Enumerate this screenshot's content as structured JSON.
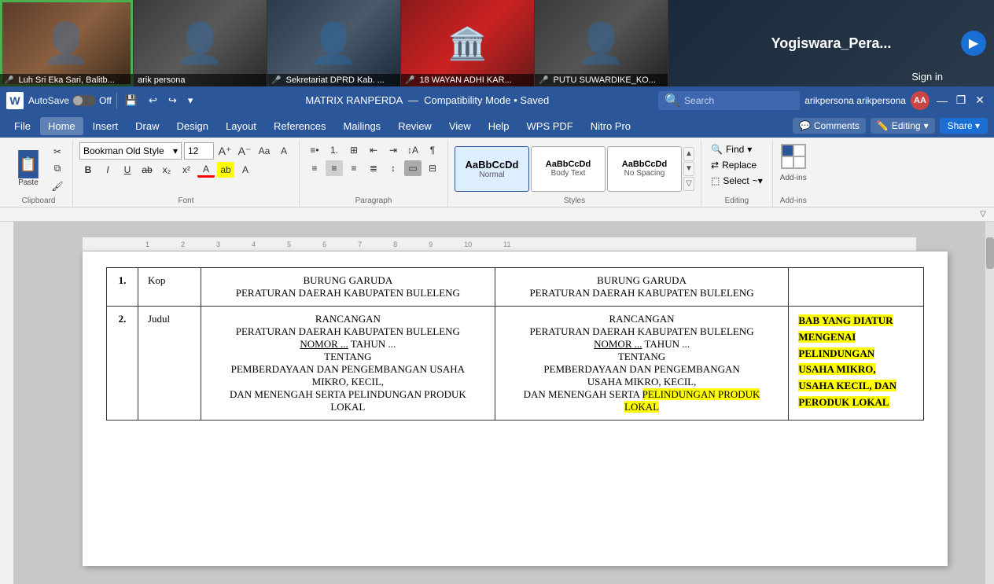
{
  "video_bar": {
    "participants": [
      {
        "id": 1,
        "name": "Luh Sri Eka Sari, Balitb...",
        "bg": "thumb-bg-1",
        "muted": true,
        "is_person": true
      },
      {
        "id": 2,
        "name": "arik persona",
        "bg": "thumb-bg-2",
        "muted": false,
        "is_person": true,
        "speaking": true
      },
      {
        "id": 3,
        "name": "Sekretariat DPRD Kab. ...",
        "bg": "thumb-bg-3",
        "muted": true,
        "is_person": true
      },
      {
        "id": 4,
        "name": "18 WAYAN ADHI KAR...",
        "bg": "thumb-bg-4",
        "muted": true,
        "is_person": false
      },
      {
        "id": 5,
        "name": "PUTU SUWARDIKE_KO...",
        "bg": "thumb-bg-5",
        "muted": true,
        "is_person": false
      }
    ],
    "featured_name": "Yogiswara_Pera...",
    "sign_in_label": "Sign in"
  },
  "app_bar": {
    "logo": "W",
    "autosave_label": "AutoSave",
    "autosave_state": "Off",
    "save_icon": "💾",
    "undo_icon": "↩",
    "redo_icon": "↪",
    "dropdown_icon": "▾",
    "doc_title": "MATRIX RANPERDA",
    "doc_subtitle": "Compatibility Mode • Saved",
    "search_placeholder": "Search",
    "user_name": "arikpersona arikpersona",
    "user_initials": "AA",
    "minimize_icon": "—",
    "restore_icon": "❐",
    "close_icon": "✕"
  },
  "menu_bar": {
    "items": [
      "File",
      "Home",
      "Insert",
      "Draw",
      "Design",
      "Layout",
      "References",
      "Mailings",
      "Review",
      "View",
      "Help",
      "WPS PDF",
      "Nitro Pro"
    ],
    "active_item": "Home",
    "comments_label": "Comments",
    "editing_label": "Editing",
    "editing_dropdown": "▾",
    "share_label": "Share",
    "share_dropdown": "▾"
  },
  "ribbon": {
    "clipboard": {
      "paste_label": "Paste",
      "cut_label": "✂",
      "copy_label": "⧉",
      "format_painter_label": "🖌"
    },
    "font": {
      "name": "Bookman Old Style",
      "size": "12",
      "grow_icon": "A↑",
      "shrink_icon": "A↓",
      "case_icon": "Aa",
      "clear_icon": "A",
      "bold": "B",
      "italic": "I",
      "underline": "U",
      "strikethrough": "ab",
      "subscript": "x₂",
      "superscript": "x²",
      "font_color": "A",
      "highlight": "ab"
    },
    "paragraph": {
      "label": "Paragraph"
    },
    "styles": {
      "label": "Styles",
      "normal_label": "Normal",
      "body_text_label": "Body Text",
      "no_spacing_label": "No Spacing",
      "normal_active": true
    },
    "editing": {
      "label": "Editing",
      "find_label": "Find",
      "replace_label": "Replace",
      "select_label": "Select",
      "select_dropdown": "~"
    },
    "addins": {
      "label": "Add-ins"
    }
  },
  "document": {
    "table": {
      "headers": [],
      "rows": [
        {
          "num": "1.",
          "label": "Kop",
          "col1": "BURUNG GARUDA\nPERATURAN DAERAH KABUPATEN BULELENG",
          "col2": "BURUNG GARUDA\nPERATURAN DAERAH KABUPATEN BULELENG",
          "note": ""
        },
        {
          "num": "2.",
          "label": "Judul",
          "col1": "RANCANGAN\nPERATURAN DAERAH KABUPATEN BULELENG\nNOMOR ... TAHUN ...\nTENTANG\nPEMBERDAYAAN DAN PENGEMBANGAN USAHA\nMIKRO, KECIL,\nDAN MENENGAH SERTA PELINDUNGAN PRODUK\nLOKAL",
          "col2_parts": [
            {
              "text": "RANCANGAN\nPERATURAN DAERAH KABUPATEN BULELENG\nNOMOR ... TAHUN ...\nTENTANG\nPEMBERDAYAAN DAN PENGEMBANGAN\nUSAHA MIKRO, KECIL,\nDAN MENENGAH SERTA ",
              "highlight": false
            },
            {
              "text": "PELINDUNGAN PRODUK",
              "highlight": true
            },
            {
              "text": "\n",
              "highlight": false
            },
            {
              "text": "LOKAL",
              "highlight": true
            }
          ],
          "note_parts": [
            {
              "text": "BAB YANG DIATUR\nMENGENAI\nPELINDUNGAN\nUSAHA MIKRO,\nUSAHA KECIL, DAN\nPERODUK LOKAL",
              "highlight": true
            }
          ]
        }
      ]
    }
  }
}
